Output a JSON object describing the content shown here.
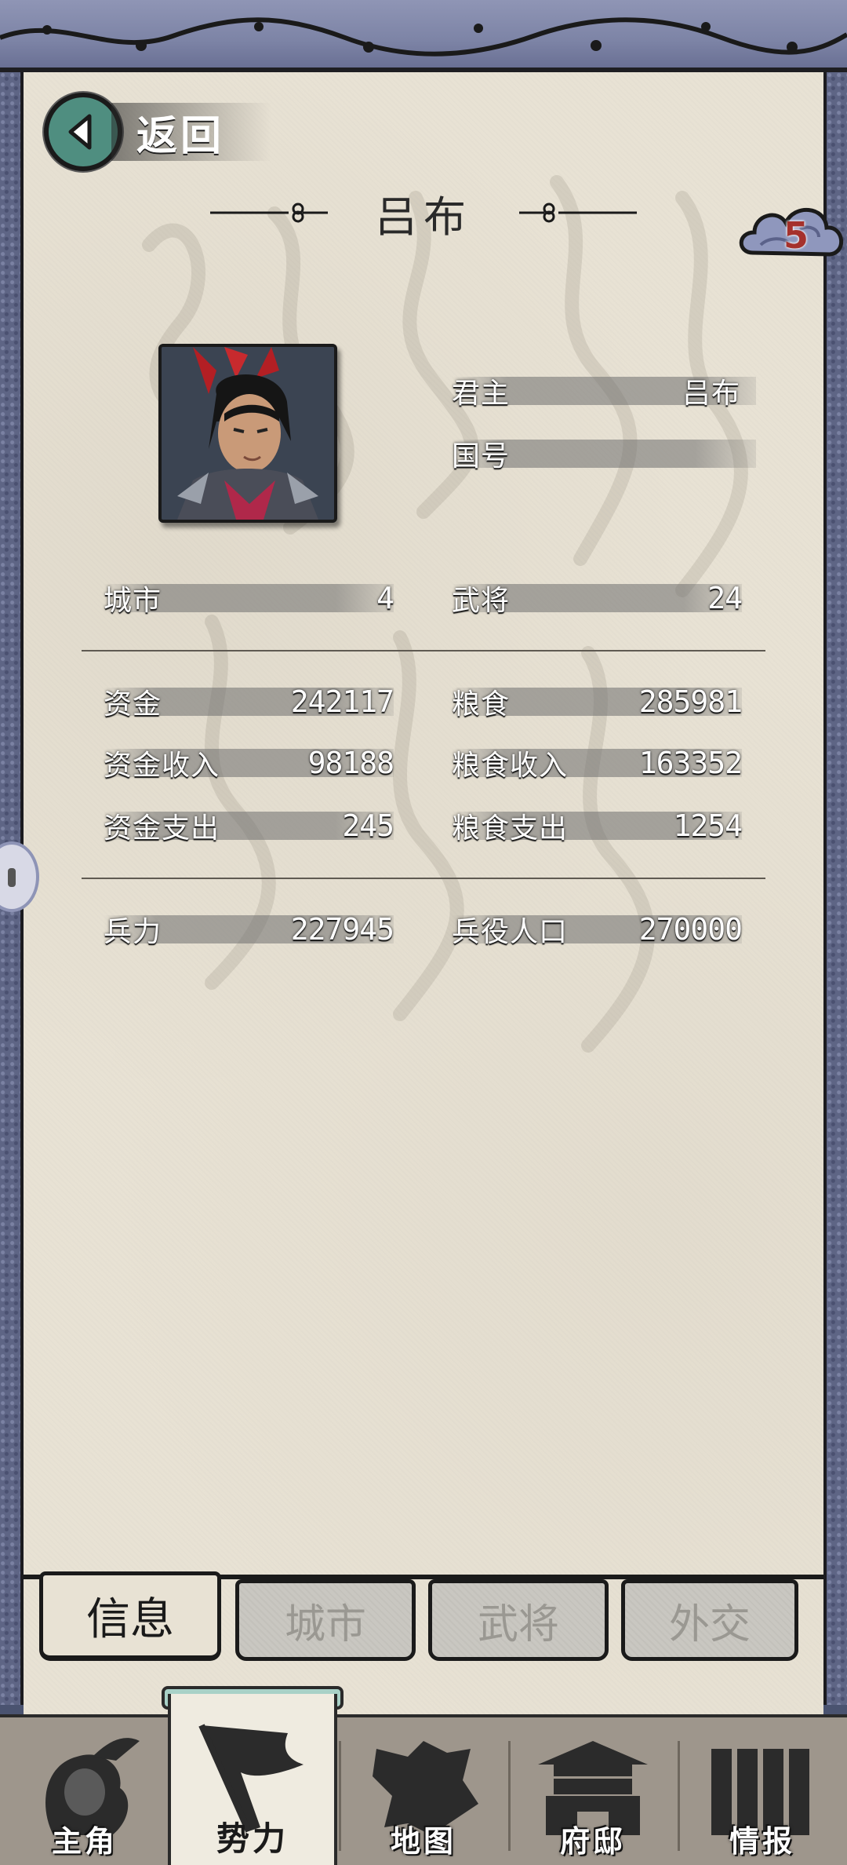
{
  "header": {
    "back_label": "返回",
    "title": "吕布",
    "badge_count": "5"
  },
  "profile": {
    "ruler_label": "君主",
    "ruler_value": "吕布",
    "country_label": "国号",
    "country_value": ""
  },
  "stats": {
    "cities_label": "城市",
    "cities_value": "4",
    "generals_label": "武将",
    "generals_value": "24",
    "funds_label": "资金",
    "funds_value": "242117",
    "food_label": "粮食",
    "food_value": "285981",
    "funds_income_label": "资金收入",
    "funds_income_value": "98188",
    "food_income_label": "粮食收入",
    "food_income_value": "163352",
    "funds_expense_label": "资金支出",
    "funds_expense_value": "245",
    "food_expense_label": "粮食支出",
    "food_expense_value": "1254",
    "troops_label": "兵力",
    "troops_value": "227945",
    "conscript_label": "兵役人口",
    "conscript_value": "270000"
  },
  "tabs": [
    "信息",
    "城市",
    "武将",
    "外交"
  ],
  "nav": [
    "主角",
    "势力",
    "地图",
    "府邸",
    "情报"
  ],
  "colors": {
    "accent_teal": "#4f8e80",
    "badge_red": "#a5312c",
    "paper": "#e8e2d4",
    "frame": "#5e6585"
  }
}
